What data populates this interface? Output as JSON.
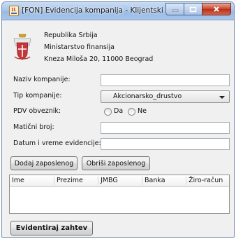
{
  "window": {
    "title": "[FON] Evidencija kompanija - Klijentski program"
  },
  "header": {
    "line1": "Republika Srbija",
    "line2": "Ministarstvo finansija",
    "line3": "Kneza Miloša 20, 11000 Beograd"
  },
  "form": {
    "naziv_label": "Naziv kompanije:",
    "naziv_value": "",
    "tip_label": "Tip kompanije:",
    "tip_selected": "Akcionarsko_drustvo",
    "pdv_label": "PDV obveznik:",
    "pdv_yes": "Da",
    "pdv_no": "Ne",
    "maticni_label": "Matični broj:",
    "maticni_value": "",
    "datum_label": "Datum i vreme evidencije:",
    "datum_value": ""
  },
  "buttons": {
    "add": "Dodaj zaposlenog",
    "remove": "Obriši zaposlenog",
    "submit": "Evidentiraj zahtev"
  },
  "table": {
    "columns": [
      "Ime",
      "Prezime",
      "JMBG",
      "Banka",
      "Žiro-račun"
    ],
    "rows": []
  },
  "colors": {
    "accent_close": "#c8432c",
    "titlebar": "#a9c5ea"
  }
}
